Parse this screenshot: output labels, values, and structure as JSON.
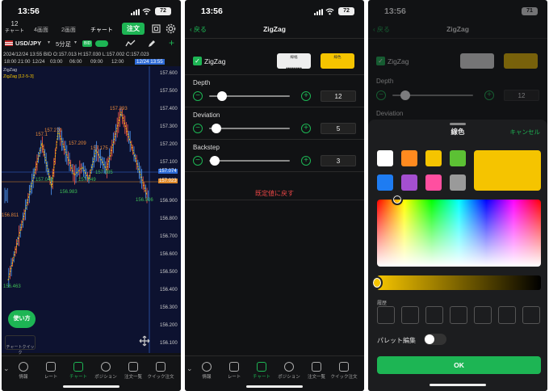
{
  "status": {
    "time1": "13:56",
    "time2": "13:56",
    "time3": "13:56",
    "battery1": "72",
    "battery2": "72",
    "battery3": "71"
  },
  "screen1": {
    "tabs": [
      {
        "label": "12\nチャート"
      },
      {
        "label": "4画面"
      },
      {
        "label": "2画面"
      },
      {
        "label": "チャート"
      }
    ],
    "order_label": "注文",
    "symbol": "USD/JPY",
    "timeframe": "5分足",
    "bid_tag": "BID",
    "ask_tag": "BID",
    "ohlc_line": "2024/12/24 13:55  BID  O:157.013  H:157.030  L:157.002  C:157.023",
    "time_labels": [
      "18:00",
      "21:00",
      "12/24",
      "03:00",
      "06:00",
      "09:00",
      "12:00",
      "12/24 13:55"
    ],
    "indicator_title": "ZigZag",
    "indicator_params": "ZigZag [12-5-3]",
    "price_labels": [
      "157.600",
      "157.500",
      "157.400",
      "157.300",
      "157.200",
      "157.100",
      "157.074",
      "157.023",
      "156.900",
      "156.800",
      "156.700",
      "156.600",
      "156.500",
      "156.400",
      "156.300",
      "156.200",
      "156.100",
      "156.000"
    ],
    "peak_labels": [
      "157.393",
      "157.270",
      "157.209",
      "157.175",
      "157.1"
    ],
    "trough_labels": [
      "156.983",
      "157.045",
      "157.049",
      "157.085",
      "156.936",
      "156.811",
      "156.463"
    ],
    "usage_button": "使い方",
    "chart_quick": "チャートクイック",
    "nav": [
      "情報",
      "レート",
      "チャート",
      "ポジション",
      "注文一覧",
      "クイック注文"
    ]
  },
  "screen2": {
    "back": "戻る",
    "title": "ZigZag",
    "indicator": "ZigZag",
    "line_width_caption": "線幅",
    "color_caption": "線色",
    "params": [
      {
        "label": "Depth",
        "value": "12",
        "level": 0.26
      },
      {
        "label": "Deviation",
        "value": "5",
        "level": 0.12
      },
      {
        "label": "Backstep",
        "value": "3",
        "level": 0.08
      }
    ],
    "reset": "既定値に戻す",
    "nav": [
      "情報",
      "レート",
      "チャート",
      "ポジション",
      "注文一覧",
      "クイック注文"
    ]
  },
  "screen3": {
    "back": "戻る",
    "title": "ZigZag",
    "indicator": "ZigZag",
    "depth_label": "Depth",
    "depth_value": "12",
    "deviation_label": "Deviation",
    "sheet_title": "線色",
    "cancel": "キャンセル",
    "swatches": [
      "#ffffff",
      "#ff8a1f",
      "#f5c400",
      "#5cc134",
      "#1e7cf2",
      "#a44fd0",
      "#ff4fa0",
      "#9a9a9a"
    ],
    "selected_color": "#f5c400",
    "history_label": "履歴",
    "palette_edit": "パレット編集",
    "ok": "OK"
  }
}
